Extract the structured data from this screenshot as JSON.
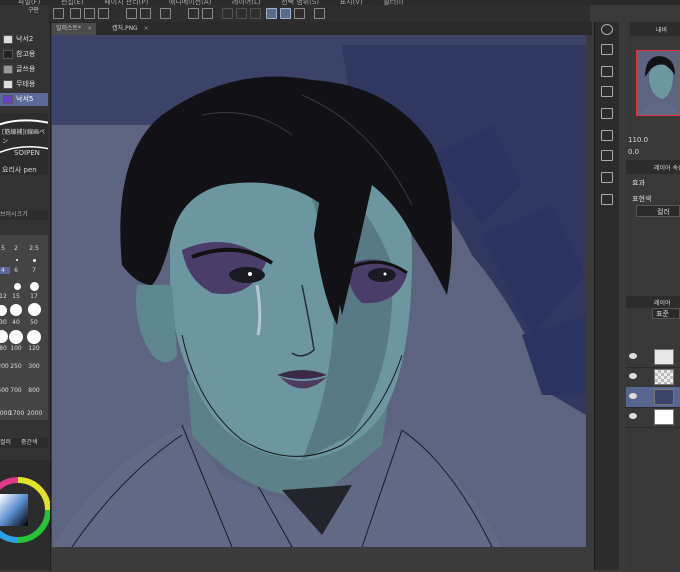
{
  "menu": {
    "items": [
      "파일(F)",
      "편집(E)",
      "페이지 관리(P)",
      "애니메이션(A)",
      "레이어(L)",
      "선택 범위(S)",
      "표시(V)",
      "필터(I)",
      "창(W)",
      "도움말(H)"
    ]
  },
  "tabs": [
    {
      "label": "일러스트*",
      "close": "×"
    },
    {
      "label": "캡처.PNG",
      "close": "×"
    }
  ],
  "left_panel": {
    "header": "구판",
    "brushes": [
      {
        "label": "낙서2"
      },
      {
        "label": "참고용"
      },
      {
        "label": "글쓰용"
      },
      {
        "label": "무테용"
      },
      {
        "label": "낙서5"
      }
    ],
    "preview_texts": [
      "[筋線補](線画ペン",
      "SOIPEN",
      "요리사 pen"
    ],
    "size_header": "브러시크기",
    "size_values": [
      "5",
      "2",
      "2.5",
      "4",
      "6",
      "7",
      "12",
      "15",
      "17",
      "30",
      "40",
      "50",
      "80",
      "100",
      "120",
      "200",
      "250",
      "300",
      "500",
      "700",
      "800",
      "1000",
      "1700",
      "2000"
    ],
    "color_tabs": [
      "컬러",
      "중간색"
    ]
  },
  "right_panel": {
    "nav_zoom": "110.0",
    "nav_angle": "0.0",
    "layer_prop_title": "레이어 속성",
    "effect_label": "효과",
    "expression_label": "표현색",
    "expression_value": "컬러",
    "layer_panel_title": "레이어",
    "blend_mode": "표준",
    "layers": [
      {
        "name": "",
        "thumb": "sketch",
        "selected": false
      },
      {
        "name": "",
        "thumb": "empty",
        "selected": false
      },
      {
        "name": "",
        "thumb": "art",
        "selected": true
      },
      {
        "name": "",
        "thumb": "white",
        "selected": false
      }
    ]
  },
  "colors": {
    "canvas_bg": "#5d6480",
    "accent": "#58658e",
    "brush_selected": "#5b6a9a"
  }
}
